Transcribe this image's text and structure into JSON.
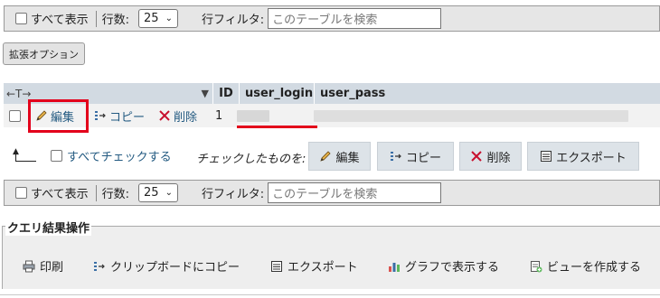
{
  "nav_top": {
    "show_all": "すべて表示",
    "rows_label": "行数:",
    "rows_value": "25",
    "filter_label": "行フィルタ:",
    "filter_placeholder": "このテーブルを検索"
  },
  "extended_options": "拡張オプション",
  "table": {
    "arrows": "←T→",
    "columns": [
      "ID",
      "user_login",
      "user_pass"
    ],
    "row": {
      "edit": "編集",
      "copy": "コピー",
      "delete": "削除",
      "id": "1"
    }
  },
  "with_selected": {
    "check_all": "すべてチェックする",
    "label": "チェックしたものを:",
    "edit": "編集",
    "copy": "コピー",
    "delete": "削除",
    "export": "エクスポート"
  },
  "nav_bottom": {
    "show_all": "すべて表示",
    "rows_label": "行数:",
    "rows_value": "25",
    "filter_label": "行フィルタ:",
    "filter_placeholder": "このテーブルを検索"
  },
  "query_ops": {
    "legend": "クエリ結果操作",
    "print": "印刷",
    "copy_clipboard": "クリップボードにコピー",
    "export": "エクスポート",
    "chart": "グラフで表示する",
    "create_view": "ビューを作成する"
  },
  "colors": {
    "link": "#235a81",
    "highlight": "#e3001b",
    "header_bg": "#d2dae2"
  }
}
